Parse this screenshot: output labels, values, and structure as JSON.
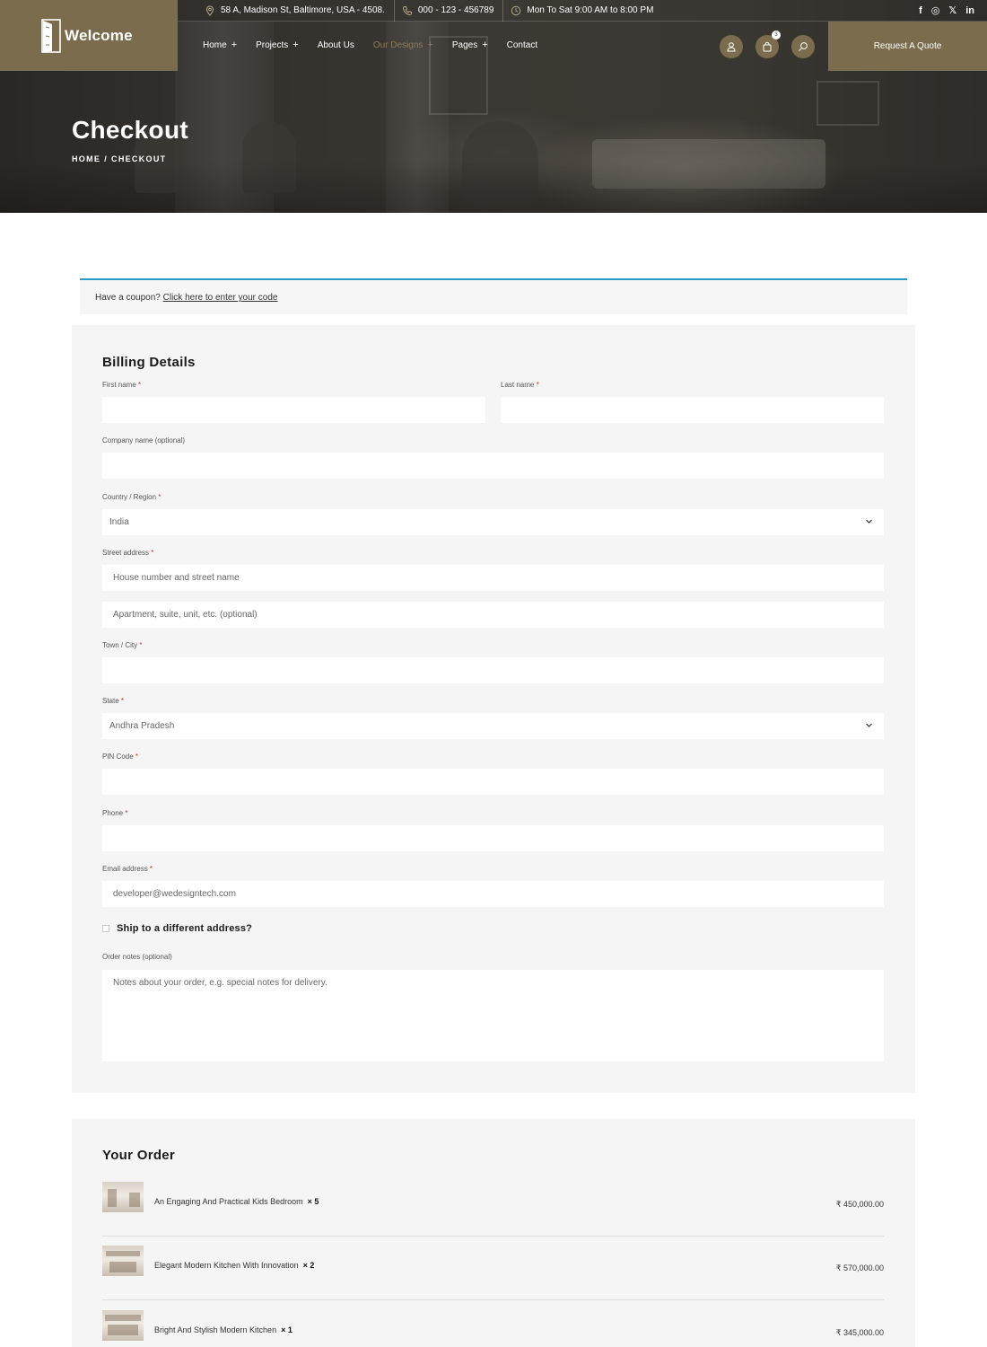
{
  "brand": {
    "name": "Welcome"
  },
  "topbar": {
    "address": "58 A, Madison St, Baltimore, USA - 4508.",
    "phone": "000 - 123 - 456789",
    "hours": "Mon To Sat 9:00 AM to 8:00 PM",
    "socials": [
      "f",
      "◎",
      "𝕏",
      "in"
    ]
  },
  "nav": {
    "items": [
      {
        "label": "Home",
        "has_sub": "+"
      },
      {
        "label": "Projects",
        "has_sub": "+"
      },
      {
        "label": "About Us",
        "has_sub": ""
      },
      {
        "label": "Our Designs",
        "has_sub": "+"
      },
      {
        "label": "Pages",
        "has_sub": "+"
      },
      {
        "label": "Contact",
        "has_sub": ""
      }
    ],
    "active_item": "Our Designs",
    "cart_count": "3",
    "quote_button": "Request A Quote"
  },
  "hero": {
    "title": "Checkout",
    "breadcrumb": [
      "HOME",
      "/",
      "CHECKOUT"
    ]
  },
  "coupon": {
    "prefix": "Have a coupon?",
    "link": "Click here to enter your code"
  },
  "billing": {
    "heading": "Billing Details",
    "required_mark": "*",
    "first_name": {
      "label": "First name",
      "value": ""
    },
    "last_name": {
      "label": "Last name",
      "value": ""
    },
    "company": {
      "label": "Company name (optional)",
      "value": ""
    },
    "country": {
      "label": "Country / Region",
      "value": "India"
    },
    "street": {
      "label": "Street address",
      "placeholder1": "House number and street name",
      "placeholder2": "Apartment, suite, unit, etc. (optional)"
    },
    "city": {
      "label": "Town / City",
      "value": ""
    },
    "state": {
      "label": "State",
      "value": "Andhra Pradesh"
    },
    "pin": {
      "label": "PIN Code",
      "value": ""
    },
    "phone": {
      "label": "Phone",
      "value": ""
    },
    "email": {
      "label": "Email address",
      "value": "developer@wedesigntech.com"
    },
    "ship_different": "Ship to a different address?",
    "notes": {
      "label": "Order notes (optional)",
      "placeholder": "Notes about your order, e.g. special notes for delivery."
    }
  },
  "order": {
    "heading": "Your Order",
    "items": [
      {
        "name": "An Engaging And Practical Kids Bedroom",
        "qty": "× 5",
        "price": "₹ 450,000.00"
      },
      {
        "name": "Elegant Modern Kitchen With Innovation",
        "qty": "× 2",
        "price": "₹ 570,000.00"
      },
      {
        "name": "Bright And Stylish Modern Kitchen",
        "qty": "× 1",
        "price": "₹ 345,000.00"
      }
    ]
  },
  "colors": {
    "accent": "#7b6c4d",
    "coupon_border": "#2a9bc6",
    "panel_bg": "#f5f5f5",
    "required": "#c0392b"
  }
}
